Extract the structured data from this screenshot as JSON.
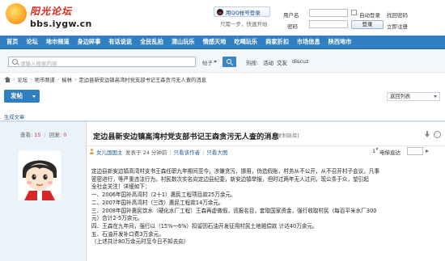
{
  "header": {
    "logo_cn": "阳光论坛",
    "logo_url": "bbs.iygw.cn",
    "qq_login": "用QQ帐号登录",
    "qq_only": "只需一步，快速开始"
  },
  "login": {
    "username_label": "用户名",
    "password_label": "密码",
    "auto_login": "自动登录",
    "find_password": "找回密码",
    "register": "立即注册",
    "login_button": "登录"
  },
  "nav": {
    "items": [
      "首页",
      "论坛",
      "地市频道",
      "身边碎事",
      "有话说说",
      "全民乱拍",
      "渭山玩乐",
      "情感天地",
      "吃喝玩乐",
      "商家折扣",
      "市场信息",
      "陕西地市"
    ]
  },
  "search": {
    "placeholder": "请输入搜索内容",
    "scope": "帖子",
    "hot_label": "热搜:",
    "hot": [
      "活动",
      "交友",
      "discuz"
    ]
  },
  "breadcrumb": {
    "items": [
      "论坛",
      "地市频道",
      "榆林",
      "定边县新安边镇高湾村党支部书记王森贪污无人查的消息"
    ]
  },
  "toolbar": {
    "post_label": "发帖",
    "return_label": "返回列表"
  },
  "gen_label": "生成文章",
  "thread": {
    "stats": {
      "views_label": "查看:",
      "views": "15",
      "replies_label": "回复:",
      "replies": "0"
    },
    "title": "定边县新安边镇高湾村党支部书记王森贪污无人查的消息",
    "copy_link": "[复制链接]",
    "author": "女儿国国主",
    "posted": "发表于 24 分钟前",
    "only_author": "只看该作者",
    "view_large": "只看大图",
    "floor": "1",
    "floor_sup": "#",
    "jump_label": "电梯直达",
    "body": [
      "定边县新安边镇高湾村支书王森任职九年期间至今，涉嫌贪污，挪用，伪造假账，村务从不公开，从不召开村子会议，凡事",
      "密密进行，等严重违法行为。村民数次实名向定边县纪委，新安边镇举报，但时过两年无人过问，现公条于众，望引起",
      "全社会关注！详细如下：",
      "一、2006年国补高湾村（2十1）惠民工程项目款25万余元。",
      "二、2007年国补高湾村（三改）惠民工程款14万余元。",
      "三、2008年国补惠民饮水（硬化水厂工程）王森再虚做假，谎报名目，套取国家资金，强行收取村民（每百平米水厂300",
      "元）合计2-5万余元。",
      "四、王森在九年间，强行以（15%一6%）扣留因石油开发征用村民土地赔偿款 计达40万余元。",
      "五、石油开发补口费3万余元。",
      "（上述共计80万余元时至今日不知去向）"
    ]
  }
}
